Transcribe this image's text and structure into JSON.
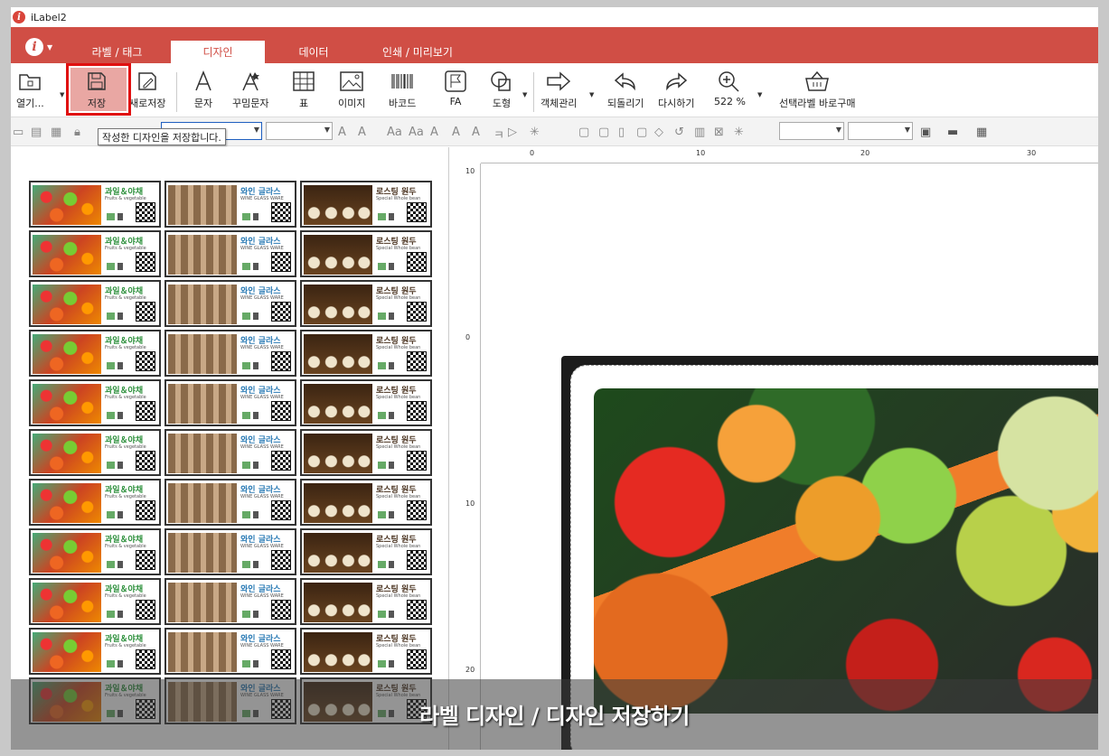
{
  "window": {
    "title": "iLabel2"
  },
  "menu": {
    "tabs": [
      {
        "label": "라벨 / 태그"
      },
      {
        "label": "디자인"
      },
      {
        "label": "데이터"
      },
      {
        "label": "인쇄 / 미리보기"
      }
    ]
  },
  "toolbar": {
    "open": "열기...",
    "save": "저장",
    "save_as": "새로저장",
    "text": "문자",
    "fancy_text": "꾸밈문자",
    "table": "표",
    "image": "이미지",
    "barcode": "바코드",
    "fa": "FA",
    "shape": "도형",
    "object_mgmt": "객체관리",
    "undo": "되돌리기",
    "redo": "다시하기",
    "zoom": "522 %",
    "buy": "선택라벨 바로구매"
  },
  "tooltip": "작성한 디자인을 저장합니다.",
  "labels": {
    "fruit": {
      "title": "과일＆야채",
      "sub": "Fruits & vegetable"
    },
    "wine": {
      "title": "와인 글라스",
      "sub": "WINE GLASS WARE"
    },
    "coffee": {
      "title": "로스팅 원두",
      "sub": "Special Whole bean"
    }
  },
  "ruler": {
    "h": [
      "0",
      "10",
      "20",
      "30"
    ],
    "v": [
      "10",
      "0",
      "10",
      "20"
    ]
  },
  "caption": "라벨 디자인 / 디자인 저장하기"
}
